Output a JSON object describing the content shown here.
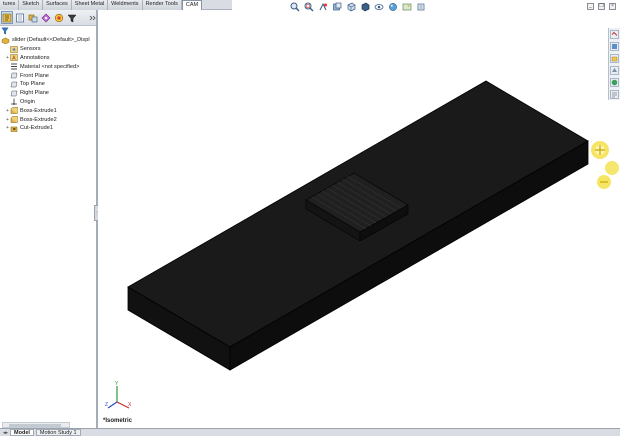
{
  "command_tabs": [
    "tures",
    "Sketch",
    "Surfaces",
    "Sheet Metal",
    "Weldments",
    "Render Tools",
    "CAM"
  ],
  "active_command_tab": "CAM",
  "hud_tools": [
    "zoom-to-fit-icon",
    "zoom-area-icon",
    "previous-view-icon",
    "section-view-icon",
    "view-orientation-icon",
    "display-style-icon",
    "hide-show-items-icon",
    "edit-appearance-icon",
    "apply-scene-icon",
    "view-settings-icon"
  ],
  "window_controls": [
    "minimize",
    "restore",
    "close"
  ],
  "feature_manager": {
    "tools": [
      "feature-manager-icon",
      "property-manager-icon",
      "configuration-manager-icon",
      "dimxpert-manager-icon",
      "display-manager-icon",
      "cam-manager-icon"
    ],
    "tree": [
      {
        "label": "slider  (Default<<Default>_Displ",
        "icon": "part-icon",
        "root": true
      },
      {
        "label": "Sensors",
        "icon": "sensors-icon"
      },
      {
        "label": "Annotations",
        "icon": "annotations-icon",
        "expandable": true
      },
      {
        "label": "Material <not specified>",
        "icon": "material-icon"
      },
      {
        "label": "Front Plane",
        "icon": "plane-icon"
      },
      {
        "label": "Top Plane",
        "icon": "plane-icon"
      },
      {
        "label": "Right Plane",
        "icon": "plane-icon"
      },
      {
        "label": "Origin",
        "icon": "origin-icon"
      },
      {
        "label": "Boss-Extrude1",
        "icon": "extrude-icon",
        "expandable": true
      },
      {
        "label": "Boss-Extrude2",
        "icon": "extrude-icon",
        "expandable": true
      },
      {
        "label": "Cut-Extrude1",
        "icon": "cut-extrude-icon",
        "expandable": true
      }
    ]
  },
  "bottom_tabs": [
    "Model",
    "Motion Study 1"
  ],
  "active_bottom_tab": "Model",
  "view_name": "*Isometric",
  "triad_labels": {
    "x": "X",
    "y": "Y",
    "z": "Z"
  },
  "task_pane_items": [
    "solidworks-resources-icon",
    "design-library-icon",
    "file-explorer-icon",
    "view-palette-icon",
    "appearances-icon",
    "custom-properties-icon"
  ],
  "colors": {
    "model_face": "#161616",
    "model_edge": "#000000",
    "rotate_widget": "#f4e04a"
  }
}
